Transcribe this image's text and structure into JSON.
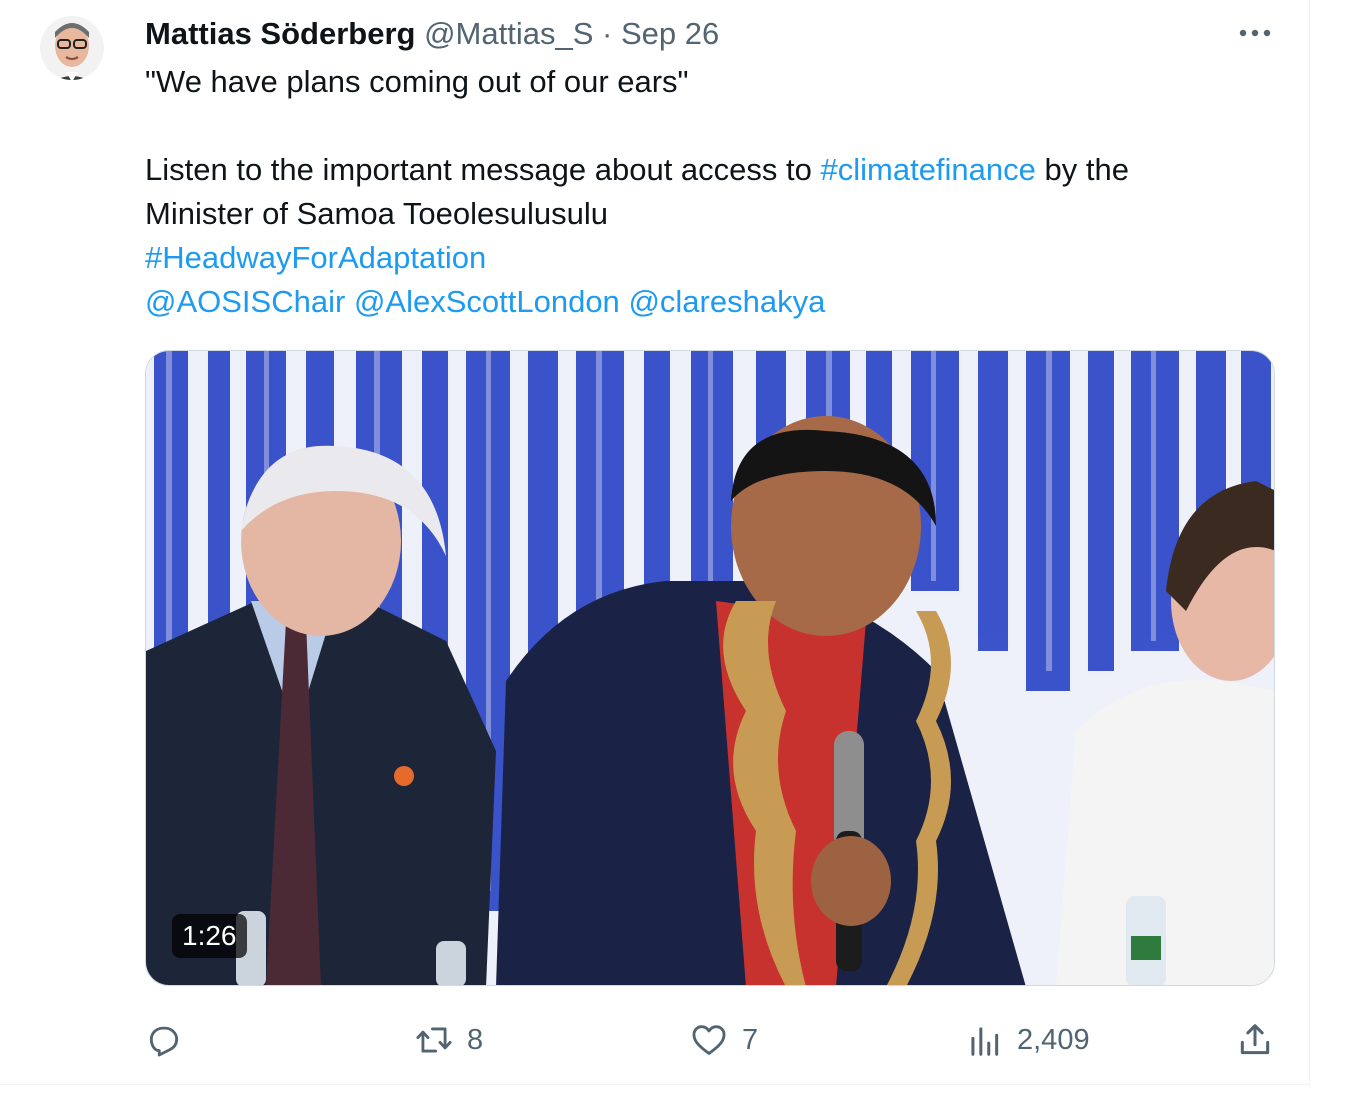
{
  "tweet": {
    "author": {
      "display_name": "Mattias Söderberg",
      "handle": "@Mattias_S",
      "separator": "·",
      "date": "Sep 26"
    },
    "lines": {
      "quote": "\"We have plans coming out of our ears\"",
      "listen_pre": "Listen to the important message about access to ",
      "hashtag_climate": "#climatefinance",
      "listen_post": " by the",
      "minister": "Minister of Samoa Toeolesulusulu",
      "hashtag_headway": "#HeadwayForAdaptation",
      "mention_1": "@AOSISChair",
      "mention_2": "@AlexScottLondon",
      "mention_3": "@clareshakya"
    },
    "media": {
      "duration": "1:26"
    },
    "actions": {
      "reply_icon": "reply-icon",
      "retweet_count": "8",
      "like_count": "7",
      "views_count": "2,409",
      "share_icon": "share-icon"
    },
    "colors": {
      "link": "#1d9bf0",
      "secondary": "#536471",
      "text": "#0f1419",
      "stage_blue": "#2b45c8"
    }
  }
}
